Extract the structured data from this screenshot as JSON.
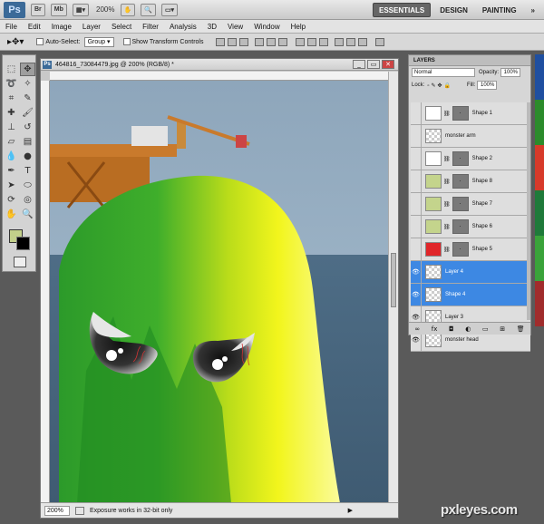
{
  "appbar": {
    "logo": "Ps",
    "buttons": [
      "Br",
      "Mb"
    ],
    "zoom": "200%",
    "workspaces": [
      "ESSENTIALS",
      "DESIGN",
      "PAINTING"
    ],
    "active_workspace": "ESSENTIALS"
  },
  "menu": [
    "File",
    "Edit",
    "Image",
    "Layer",
    "Select",
    "Filter",
    "Analysis",
    "3D",
    "View",
    "Window",
    "Help"
  ],
  "options": {
    "auto_select_label": "Auto-Select:",
    "auto_select_value": "Group",
    "transform_label": "Show Transform Controls"
  },
  "document": {
    "title": "464816_73084479.jpg @ 200% (RGB/8) *",
    "zoom": "200%",
    "status": "Exposure works in 32-bit only",
    "ruler_top_label": "",
    "ruler_corner_mark": "3"
  },
  "tools": {
    "foreground": "#c2d08a",
    "background": "#000000"
  },
  "layers_panel": {
    "tab": "LAYERS",
    "blend_mode": "Normal",
    "opacity_label": "Opacity:",
    "opacity": "100%",
    "lock_label": "Lock:",
    "fill_label": "Fill:",
    "fill": "100%",
    "rows": [
      {
        "name": "Shape 1",
        "thumb": "#ffffff",
        "has_mask": true,
        "visible": false,
        "selected": false
      },
      {
        "name": "monster arm",
        "thumb": "checker",
        "has_mask": false,
        "visible": false,
        "selected": false
      },
      {
        "name": "Shape 2",
        "thumb": "#ffffff",
        "has_mask": true,
        "visible": false,
        "selected": false
      },
      {
        "name": "Shape 8",
        "thumb": "#c4d48c",
        "has_mask": true,
        "visible": false,
        "selected": false
      },
      {
        "name": "Shape 7",
        "thumb": "#c4d48c",
        "has_mask": true,
        "visible": false,
        "selected": false
      },
      {
        "name": "Shape 6",
        "thumb": "#c4d48c",
        "has_mask": true,
        "visible": false,
        "selected": false
      },
      {
        "name": "Shape 5",
        "thumb": "#e0262a",
        "has_mask": true,
        "visible": false,
        "selected": false
      },
      {
        "name": "Layer 4",
        "thumb": "checker",
        "has_mask": false,
        "visible": true,
        "selected": true
      },
      {
        "name": "Shape 4",
        "thumb": "checker",
        "has_mask": false,
        "visible": true,
        "selected": true
      },
      {
        "name": "Layer 3",
        "thumb": "checker",
        "has_mask": false,
        "visible": true,
        "selected": false
      },
      {
        "name": "monster head",
        "thumb": "checker",
        "has_mask": false,
        "visible": true,
        "selected": false
      }
    ]
  },
  "watermark": "pxleyes.com"
}
